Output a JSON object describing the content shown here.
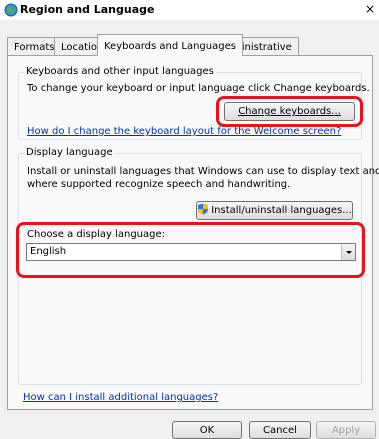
{
  "window": {
    "title": "Region and Language",
    "close_glyph": "×"
  },
  "tabs": [
    {
      "label": "Formats"
    },
    {
      "label": "Location"
    },
    {
      "label": "Keyboards and Languages"
    },
    {
      "label": "Administrative"
    }
  ],
  "keyboards_group": {
    "legend": "Keyboards and other input languages",
    "description": "To change your keyboard or input language click Change keyboards.",
    "change_button": "Change keyboards...",
    "welcome_link": "How do I change the keyboard layout for the Welcome screen?"
  },
  "display_group": {
    "legend": "Display language",
    "description_line1": "Install or uninstall languages that Windows can use to display text and",
    "description_line2": "where supported recognize speech and handwriting.",
    "install_button": "Install/uninstall languages...",
    "choose_label": "Choose a display language:",
    "selected_language": "English"
  },
  "footer_link": "How can I install additional languages?",
  "buttons": {
    "ok": "OK",
    "cancel": "Cancel",
    "apply": "Apply"
  },
  "colors": {
    "highlight": "#e8141a",
    "link": "#0033aa"
  }
}
